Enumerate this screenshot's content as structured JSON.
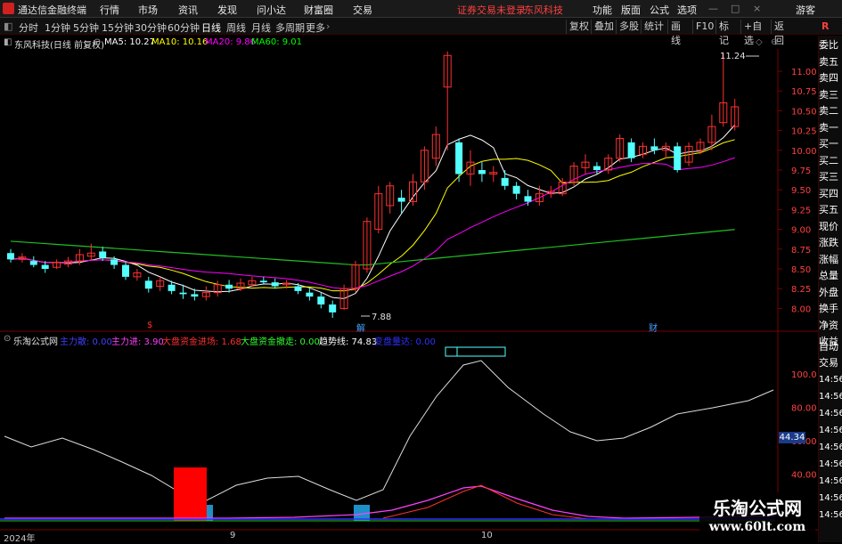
{
  "menubar": {
    "app_name": "通达信金融终端",
    "items": [
      "行情",
      "市场",
      "资讯",
      "发现",
      "问小达",
      "财富圈",
      "交易"
    ],
    "status": "证券交易未登录",
    "stock_name": "东风科技",
    "right_items": [
      "功能",
      "版面",
      "公式",
      "选项"
    ],
    "user": "游客"
  },
  "toolbar": {
    "periods": [
      "分时",
      "1分钟",
      "5分钟",
      "15分钟",
      "30分钟",
      "60分钟",
      "日线",
      "周线",
      "月线",
      "多周期",
      "更多"
    ],
    "active_period": "日线",
    "right_buttons": [
      "复权",
      "叠加",
      "多股",
      "统计",
      "画线",
      "F10",
      "标记",
      "+自选",
      "返回"
    ]
  },
  "main_chart": {
    "title": "东风科技(日线 前复权)",
    "ma": [
      {
        "label": "MA5: 10.27",
        "color": "#ffffff"
      },
      {
        "label": "MA10: 10.16",
        "color": "#ffff00"
      },
      {
        "label": "MA20: 9.86",
        "color": "#ff00ff"
      },
      {
        "label": "MA60: 9.01",
        "color": "#00ff00"
      }
    ],
    "high_label": "11.24",
    "low_label": "7.88",
    "y_ticks": [
      "11.00",
      "10.75",
      "10.50",
      "10.25",
      "10.00",
      "9.75",
      "9.50",
      "9.25",
      "9.00",
      "8.75",
      "8.50",
      "8.25",
      "8.00"
    ],
    "markers": [
      "$",
      "解",
      "财"
    ]
  },
  "indicator": {
    "title": "乐淘公式网",
    "items": [
      {
        "label": "主力散: 0.00",
        "color": "#4040ff"
      },
      {
        "label": "主力进: 3.90",
        "color": "#ff40ff"
      },
      {
        "label": "大盘资金进场: 1.68",
        "color": "#ff3030"
      },
      {
        "label": "大盘资金撤走: 0.00",
        "color": "#30ff30"
      },
      {
        "label": "趋势线: 74.83",
        "color": "#ffffff"
      },
      {
        "label": "变盘量达: 0.00",
        "color": "#3030ff"
      }
    ],
    "y_ticks": [
      "100.0",
      "80.00",
      "60.00",
      "40.00"
    ],
    "current_value": "44.34"
  },
  "x_axis": {
    "labels": [
      "2024年",
      "9",
      "10"
    ]
  },
  "side_panel": {
    "items": [
      "委比",
      "卖五",
      "卖四",
      "卖三",
      "卖二",
      "卖一",
      "买一",
      "买二",
      "买三",
      "买四",
      "买五",
      "现价",
      "涨跌",
      "涨幅",
      "总量",
      "外盘",
      "换手",
      "净资",
      "收益",
      "自动",
      "交易",
      "14:56",
      "14:56",
      "14:56",
      "14:56",
      "14:56",
      "14:56",
      "14:56",
      "14:56",
      "14:56"
    ]
  },
  "watermark": {
    "title": "乐淘公式网",
    "url": "www.60lt.com"
  }
}
